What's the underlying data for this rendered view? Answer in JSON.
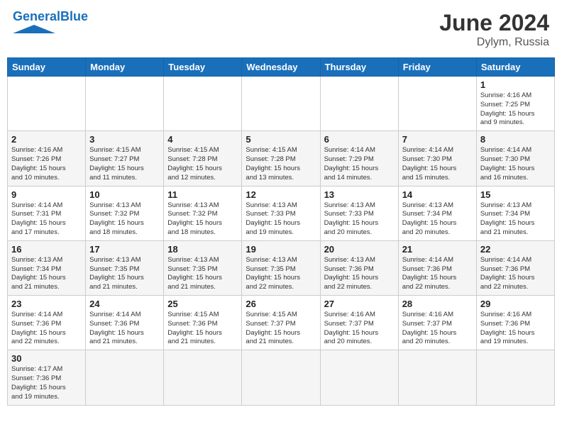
{
  "header": {
    "logo_general": "General",
    "logo_blue": "Blue",
    "month": "June 2024",
    "location": "Dylym, Russia"
  },
  "weekdays": [
    "Sunday",
    "Monday",
    "Tuesday",
    "Wednesday",
    "Thursday",
    "Friday",
    "Saturday"
  ],
  "weeks": [
    [
      {
        "day": "",
        "info": ""
      },
      {
        "day": "",
        "info": ""
      },
      {
        "day": "",
        "info": ""
      },
      {
        "day": "",
        "info": ""
      },
      {
        "day": "",
        "info": ""
      },
      {
        "day": "",
        "info": ""
      },
      {
        "day": "1",
        "info": "Sunrise: 4:16 AM\nSunset: 7:25 PM\nDaylight: 15 hours\nand 9 minutes."
      }
    ],
    [
      {
        "day": "2",
        "info": "Sunrise: 4:16 AM\nSunset: 7:26 PM\nDaylight: 15 hours\nand 10 minutes."
      },
      {
        "day": "3",
        "info": "Sunrise: 4:15 AM\nSunset: 7:27 PM\nDaylight: 15 hours\nand 11 minutes."
      },
      {
        "day": "4",
        "info": "Sunrise: 4:15 AM\nSunset: 7:28 PM\nDaylight: 15 hours\nand 12 minutes."
      },
      {
        "day": "5",
        "info": "Sunrise: 4:15 AM\nSunset: 7:28 PM\nDaylight: 15 hours\nand 13 minutes."
      },
      {
        "day": "6",
        "info": "Sunrise: 4:14 AM\nSunset: 7:29 PM\nDaylight: 15 hours\nand 14 minutes."
      },
      {
        "day": "7",
        "info": "Sunrise: 4:14 AM\nSunset: 7:30 PM\nDaylight: 15 hours\nand 15 minutes."
      },
      {
        "day": "8",
        "info": "Sunrise: 4:14 AM\nSunset: 7:30 PM\nDaylight: 15 hours\nand 16 minutes."
      }
    ],
    [
      {
        "day": "9",
        "info": "Sunrise: 4:14 AM\nSunset: 7:31 PM\nDaylight: 15 hours\nand 17 minutes."
      },
      {
        "day": "10",
        "info": "Sunrise: 4:13 AM\nSunset: 7:32 PM\nDaylight: 15 hours\nand 18 minutes."
      },
      {
        "day": "11",
        "info": "Sunrise: 4:13 AM\nSunset: 7:32 PM\nDaylight: 15 hours\nand 18 minutes."
      },
      {
        "day": "12",
        "info": "Sunrise: 4:13 AM\nSunset: 7:33 PM\nDaylight: 15 hours\nand 19 minutes."
      },
      {
        "day": "13",
        "info": "Sunrise: 4:13 AM\nSunset: 7:33 PM\nDaylight: 15 hours\nand 20 minutes."
      },
      {
        "day": "14",
        "info": "Sunrise: 4:13 AM\nSunset: 7:34 PM\nDaylight: 15 hours\nand 20 minutes."
      },
      {
        "day": "15",
        "info": "Sunrise: 4:13 AM\nSunset: 7:34 PM\nDaylight: 15 hours\nand 21 minutes."
      }
    ],
    [
      {
        "day": "16",
        "info": "Sunrise: 4:13 AM\nSunset: 7:34 PM\nDaylight: 15 hours\nand 21 minutes."
      },
      {
        "day": "17",
        "info": "Sunrise: 4:13 AM\nSunset: 7:35 PM\nDaylight: 15 hours\nand 21 minutes."
      },
      {
        "day": "18",
        "info": "Sunrise: 4:13 AM\nSunset: 7:35 PM\nDaylight: 15 hours\nand 21 minutes."
      },
      {
        "day": "19",
        "info": "Sunrise: 4:13 AM\nSunset: 7:35 PM\nDaylight: 15 hours\nand 22 minutes."
      },
      {
        "day": "20",
        "info": "Sunrise: 4:13 AM\nSunset: 7:36 PM\nDaylight: 15 hours\nand 22 minutes."
      },
      {
        "day": "21",
        "info": "Sunrise: 4:14 AM\nSunset: 7:36 PM\nDaylight: 15 hours\nand 22 minutes."
      },
      {
        "day": "22",
        "info": "Sunrise: 4:14 AM\nSunset: 7:36 PM\nDaylight: 15 hours\nand 22 minutes."
      }
    ],
    [
      {
        "day": "23",
        "info": "Sunrise: 4:14 AM\nSunset: 7:36 PM\nDaylight: 15 hours\nand 22 minutes."
      },
      {
        "day": "24",
        "info": "Sunrise: 4:14 AM\nSunset: 7:36 PM\nDaylight: 15 hours\nand 21 minutes."
      },
      {
        "day": "25",
        "info": "Sunrise: 4:15 AM\nSunset: 7:36 PM\nDaylight: 15 hours\nand 21 minutes."
      },
      {
        "day": "26",
        "info": "Sunrise: 4:15 AM\nSunset: 7:37 PM\nDaylight: 15 hours\nand 21 minutes."
      },
      {
        "day": "27",
        "info": "Sunrise: 4:16 AM\nSunset: 7:37 PM\nDaylight: 15 hours\nand 20 minutes."
      },
      {
        "day": "28",
        "info": "Sunrise: 4:16 AM\nSunset: 7:37 PM\nDaylight: 15 hours\nand 20 minutes."
      },
      {
        "day": "29",
        "info": "Sunrise: 4:16 AM\nSunset: 7:36 PM\nDaylight: 15 hours\nand 19 minutes."
      }
    ],
    [
      {
        "day": "30",
        "info": "Sunrise: 4:17 AM\nSunset: 7:36 PM\nDaylight: 15 hours\nand 19 minutes."
      },
      {
        "day": "",
        "info": ""
      },
      {
        "day": "",
        "info": ""
      },
      {
        "day": "",
        "info": ""
      },
      {
        "day": "",
        "info": ""
      },
      {
        "day": "",
        "info": ""
      },
      {
        "day": "",
        "info": ""
      }
    ]
  ]
}
